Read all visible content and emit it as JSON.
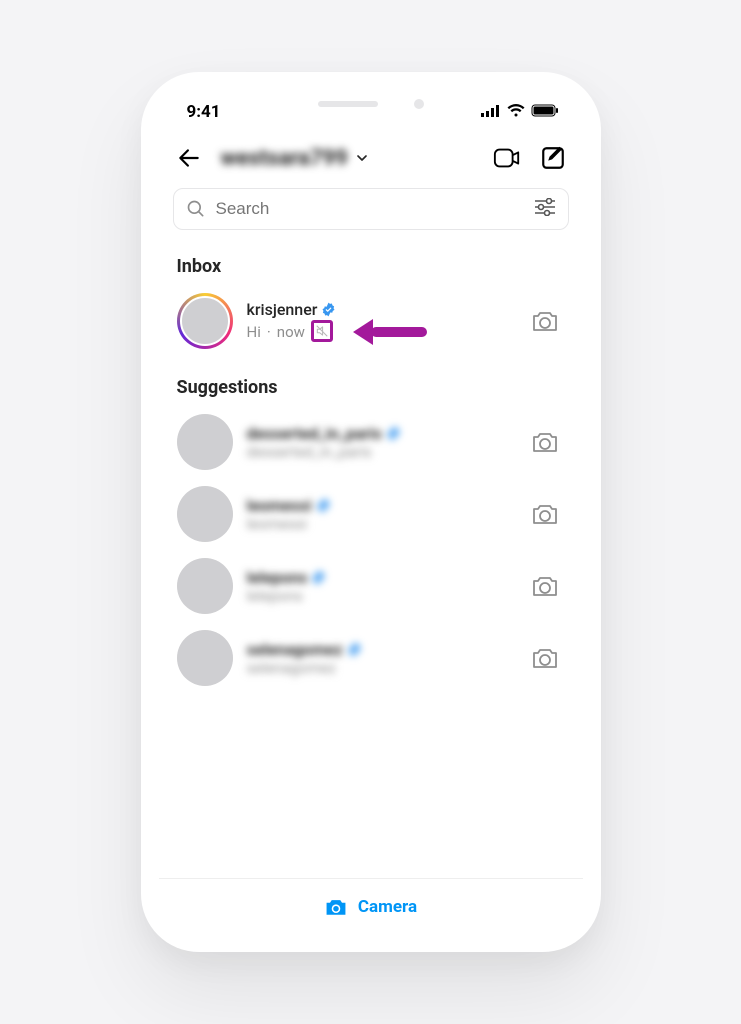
{
  "status": {
    "time": "9:41"
  },
  "nav": {
    "username": "westsara799",
    "back_label": "Back",
    "video_label": "Video call",
    "compose_label": "New message"
  },
  "search": {
    "placeholder": "Search"
  },
  "sections": {
    "inbox_title": "Inbox",
    "suggestions_title": "Suggestions"
  },
  "inbox": [
    {
      "username": "krisjenner",
      "verified": true,
      "preview": "Hi",
      "separator": "·",
      "timestamp": "now",
      "muted": true,
      "has_story": true
    }
  ],
  "suggestions": [
    {
      "username": "desserted_in_paris",
      "subtitle": "desserted_in_paris",
      "verified": true
    },
    {
      "username": "leomessi",
      "subtitle": "leomessi",
      "verified": true
    },
    {
      "username": "lelepons",
      "subtitle": "lelepons",
      "verified": true
    },
    {
      "username": "selenagomez",
      "subtitle": "selenagomez",
      "verified": true
    }
  ],
  "bottom": {
    "camera_label": "Camera"
  },
  "colors": {
    "accent": "#0095f6",
    "annotation": "#a3199b"
  }
}
